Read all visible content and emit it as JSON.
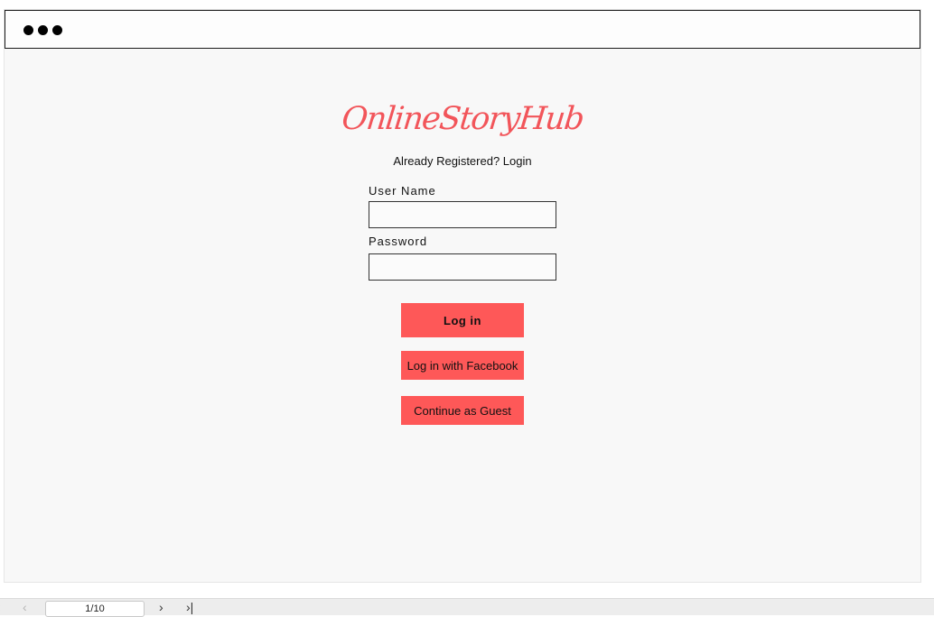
{
  "browser": {
    "window_controls": "three-dots-icon"
  },
  "logo": {
    "text": "OnlineStoryHub"
  },
  "subtitle": "Already Registered? Login",
  "form": {
    "username_label": "User Name",
    "username_value": "",
    "password_label": "Password",
    "password_value": ""
  },
  "buttons": {
    "login": "Log in",
    "facebook": "Log in with Facebook",
    "guest": "Continue as Guest"
  },
  "pager": {
    "first_icon": "first-page-icon",
    "prev_icon": "chevron-left-icon",
    "page_text": "1/10",
    "next_icon": "chevron-right-icon",
    "last_icon": "last-page-icon"
  },
  "colors": {
    "accent": "#fe5858",
    "logo": "#f2555a",
    "canvas": "#f8f8f8"
  }
}
